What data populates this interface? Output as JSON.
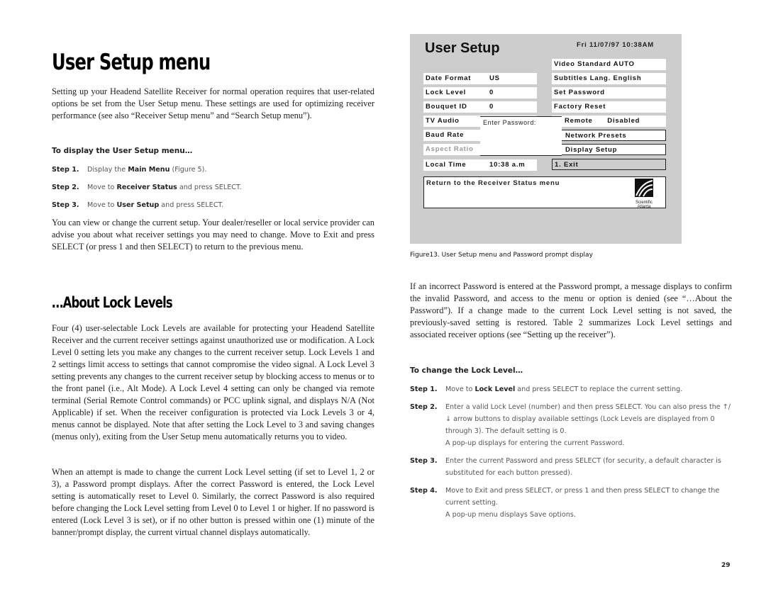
{
  "left": {
    "title": "User Setup menu",
    "intro": "Setting up your Headend Satellite Receiver for normal operation requires that user-related options be set from the User Setup menu. These settings are used for optimizing receiver performance (see also “Receiver Setup menu” and “Search Setup menu”).",
    "display_heading": "To display the User Setup menu…",
    "display_steps": [
      {
        "num": "Step 1.",
        "pre": "Display the ",
        "bold": "Main Menu",
        "post": " (Figure 5)."
      },
      {
        "num": "Step 2.",
        "pre": "Move to ",
        "bold": "Receiver Status",
        "post": " and press SELECT."
      },
      {
        "num": "Step 3.",
        "pre": "Move to ",
        "bold": "User Setup",
        "post": " and press SELECT."
      }
    ],
    "view_para": "You can view or change the current setup. Your dealer/reseller or local service provider can advise you about what receiver settings you may need to change. Move to Exit and press SELECT (or press 1 and then SELECT) to return to the previous menu.",
    "lock_title": "…About Lock Levels",
    "lock_para1": "Four (4) user-selectable Lock Levels are available for protecting your Headend Satellite Receiver and the current receiver settings against unauthorized use or modification. A Lock Level 0 setting lets you make any changes to the current receiver setup. Lock Levels 1 and 2 settings limit access to settings that cannot compromise the video signal. A Lock Level 3 setting prevents any changes to the current receiver setup by blocking access to menus or to the front panel (i.e., Alt Mode). A Lock Level 4 setting can only be changed via remote terminal (Serial Remote Control commands) or PCC uplink signal, and displays N/A (Not Applicable) if set. When the receiver configuration is protected via Lock Levels 3 or 4, menus cannot be displayed. Note that after setting the Lock Level to 3 and saving changes (menus only), exiting from the User Setup menu automatically returns you to video.",
    "lock_para2": "When an attempt is made to change the current Lock Level setting (if set to Level 1, 2 or 3), a Password prompt displays. After the correct Password is entered, the Lock Level setting is automatically reset to Level 0. Similarly, the correct Password is also required before changing the Lock Level setting from Level 0 to Level 1 or higher. If no password is entered (Lock Level 3 is set), or if no other button is pressed within one (1) minute of the banner/prompt display, the current virtual channel displays automatically."
  },
  "figure": {
    "screen_title": "User Setup",
    "datetime": "Fri 11/07/97 10:38AM",
    "left_items": [
      {
        "label": "Date Format",
        "value": "US"
      },
      {
        "label": "Lock Level",
        "value": "0"
      },
      {
        "label": "Bouquet ID",
        "value": "0"
      },
      {
        "label": "TV Audio",
        "value": ""
      },
      {
        "label": "Baud Rate",
        "value": ""
      },
      {
        "label": "Aspect Ratio",
        "value": ""
      },
      {
        "label": "Local Time",
        "value": "10:38 a.m"
      }
    ],
    "right_items": [
      "Video Standard AUTO",
      "Subtitles Lang. English",
      "Set Password",
      "Factory Reset",
      "Remote      Disabled",
      "Network Presets",
      "Display Setup",
      "1. Exit"
    ],
    "popup_prompt": "Enter Password:",
    "help_text": "Return to the Receiver Status menu",
    "logo_text": "Scientific Atlanta",
    "caption": "Figure13. User Setup menu and Password prompt display"
  },
  "right": {
    "password_para": "If an incorrect Password is entered at the Password prompt, a message displays to confirm the invalid Password, and access to the menu or option is denied (see “…About the Password”). If a change made to the current Lock Level setting is not saved, the previously-saved setting is restored. Table 2 summarizes Lock Level settings and associated receiver options (see “Setting up the receiver”).",
    "change_heading": "To change the Lock Level…",
    "s1_num": "Step 1.",
    "s1_pre": "Move to ",
    "s1_bold": "Lock Level",
    "s1_post": " and press SELECT to replace the current setting.",
    "s2_num": "Step 2.",
    "s2_text": "Enter a valid Lock Level (number) and then press SELECT. You can also press the ↑/↓ arrow buttons to display available settings (Lock Levels are displayed from 0 through 3). The default setting is 0.",
    "s2_note": "A pop-up displays for entering the current Password.",
    "s3_num": "Step 3.",
    "s3_text": "Enter the current Password and press SELECT (for security, a default character is substituted for each button pressed).",
    "s4_num": "Step 4.",
    "s4_text": "Move to Exit and press SELECT, or press 1 and then press SELECT to change the current setting.",
    "s4_note": "A pop-up menu displays Save options."
  },
  "page_number": "29"
}
